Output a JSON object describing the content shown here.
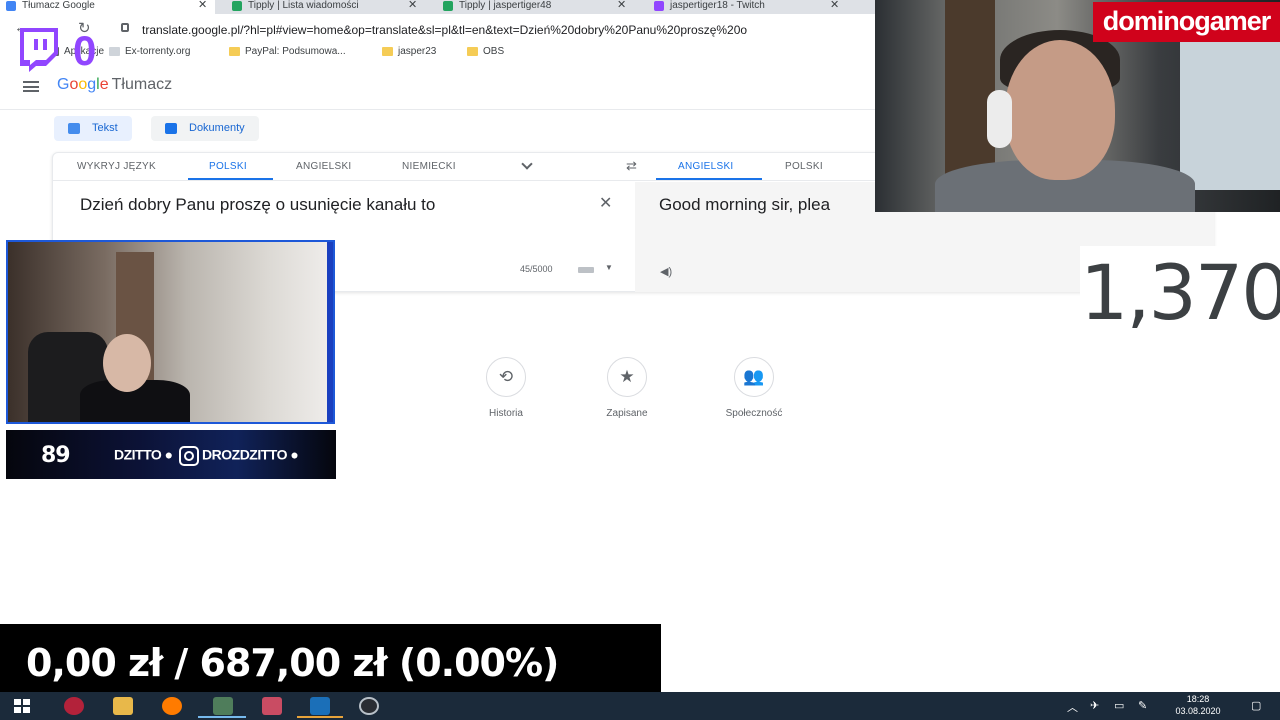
{
  "browser": {
    "tabs": [
      {
        "label": "Tłumacz Google",
        "fav": "#4285f4"
      },
      {
        "label": "Tipply | Lista wiadomości",
        "fav": "#23a45f"
      },
      {
        "label": "Tipply | jaspertiger48",
        "fav": "#23a45f"
      },
      {
        "label": "jaspertiger18 - Twitch",
        "fav": "#9146ff"
      }
    ],
    "url": "translate.google.pl/?hl=pl#view=home&op=translate&sl=pl&tl=en&text=Dzień%20dobry%20Panu%20proszę%20o",
    "bookmarks": [
      "Aplikacje",
      "Ex-torrenty.org",
      "PayPal: Podsumowa...",
      "jasper23",
      "OBS"
    ]
  },
  "translate": {
    "logo": {
      "g1": "G",
      "g2": "o",
      "g3": "o",
      "g4": "g",
      "g5": "l",
      "g6": "e",
      "product": "Tłumacz"
    },
    "modes": {
      "text": "Tekst",
      "documents": "Dokumenty"
    },
    "source_langs": {
      "detect": "WYKRYJ JĘZYK",
      "polish": "POLSKI",
      "english": "ANGIELSKI",
      "german": "NIEMIECKI"
    },
    "target_langs": {
      "english": "ANGIELSKI",
      "polish": "POLSKI"
    },
    "source_text": "Dzień dobry Panu proszę o usunięcie kanału to",
    "target_text": "Good morning sir, plea",
    "char_count": "45/5000",
    "shortcuts": {
      "history": "Historia",
      "saved": "Zapisane",
      "community": "Społeczność"
    }
  },
  "overlay": {
    "twitch_viewers": "0",
    "streamer_name": "dominogamer",
    "big_counter": "1,370",
    "social_number": "89",
    "social_left": "DZITTO ●",
    "social_handle": "DROZDZITTO ●",
    "donation": "0,00 zł / 687,00 zł (0.00%)"
  },
  "taskbar": {
    "time": "18:28",
    "date": "03.08.2020"
  },
  "colors": {
    "accent": "#1a73e8",
    "twitch": "#9146ff",
    "streamer_bg": "#d0021b",
    "taskbar": "#1b2a3a"
  }
}
